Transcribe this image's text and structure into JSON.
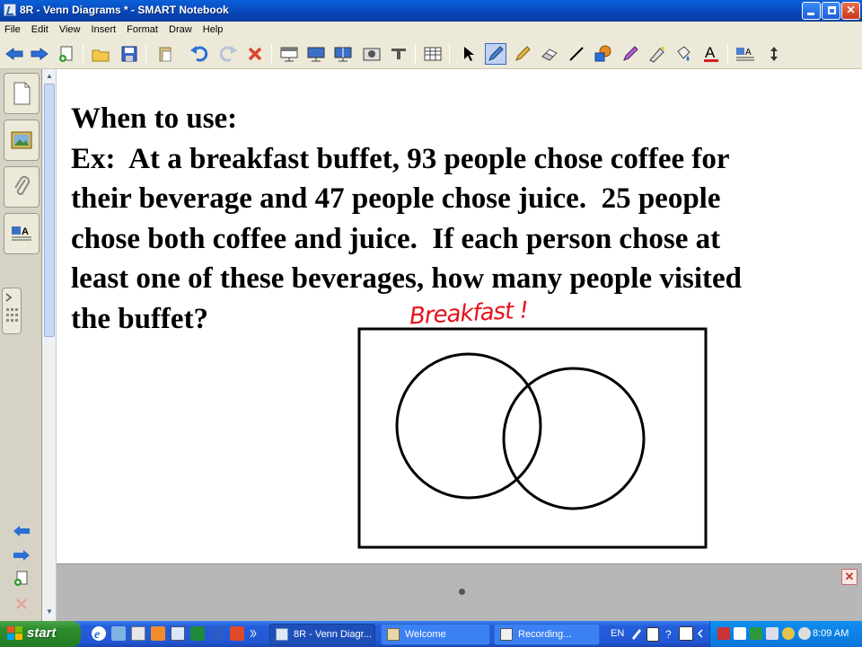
{
  "window": {
    "title": "8R - Venn Diagrams * - SMART Notebook"
  },
  "menu": [
    "File",
    "Edit",
    "View",
    "Insert",
    "Format",
    "Draw",
    "Help"
  ],
  "toolbar": {
    "icons": [
      "back-arrow-icon",
      "forward-arrow-icon",
      "add-page-icon",
      "open-folder-icon",
      "save-icon",
      "paste-icon",
      "undo-icon",
      "redo-icon",
      "delete-icon",
      "screen-shade-icon",
      "full-screen-icon",
      "dual-page-icon",
      "screen-capture-icon",
      "document-camera-icon",
      "table-icon",
      "select-icon",
      "pen-icon",
      "creative-pen-icon",
      "eraser-icon",
      "line-icon",
      "shapes-icon",
      "magic-pen-icon",
      "fill-icon",
      "text-icon",
      "properties-icon",
      "move-toolbar-icon"
    ]
  },
  "page": {
    "heading": "When to use:",
    "lines": [
      "Ex:  At a breakfast buffet, 93 people chose coffee for",
      "their beverage and 47 people chose juice.  25 people",
      "chose both coffee and juice.  If each person chose at",
      "least one of these beverages, how many people visited",
      "the buffet?"
    ],
    "annotation": "Breakfast !"
  },
  "colors": {
    "annotation": "#e8101a",
    "taskbar": "#245edb",
    "start": "#2d8e2d"
  },
  "taskbar": {
    "start_label": "start",
    "tasks": [
      "8R - Venn Diagr...",
      "Welcome",
      "Recording..."
    ],
    "language": "EN",
    "clock": "8:09 AM"
  }
}
